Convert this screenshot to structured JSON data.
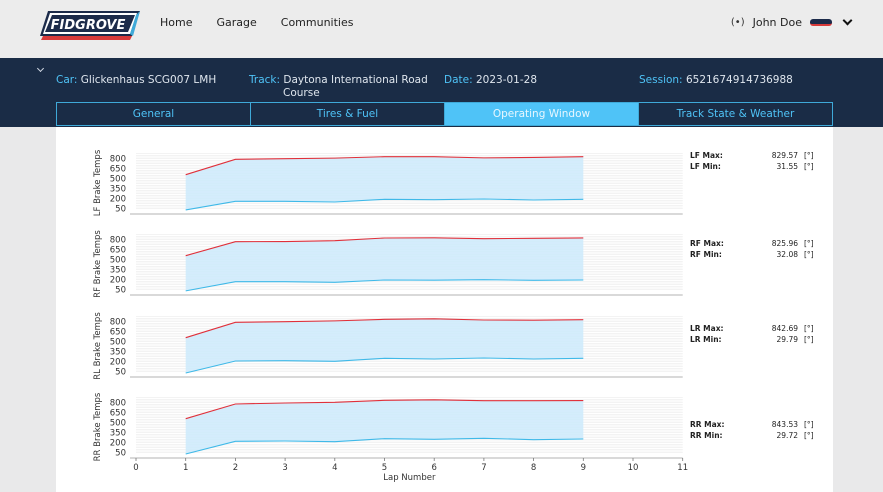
{
  "nav": {
    "brand": "FIDGROVE",
    "links": [
      "Home",
      "Garage",
      "Communities"
    ],
    "user_name": "John Doe"
  },
  "session_info": {
    "car_label": "Car:",
    "car": "Glickenhaus SCG007 LMH",
    "track_label": "Track:",
    "track_line1": "Daytona International Road",
    "track_line2": "Course",
    "date_label": "Date:",
    "date": "2023-01-28",
    "session_label": "Session:",
    "session": "6521674914736988"
  },
  "tabs": [
    {
      "label": "General",
      "active": false
    },
    {
      "label": "Tires & Fuel",
      "active": false
    },
    {
      "label": "Operating Window",
      "active": true
    },
    {
      "label": "Track State & Weather",
      "active": false
    }
  ],
  "colors": {
    "max_line": "#e0303a",
    "min_line": "#3fb9e8",
    "fill": "#cdeafb",
    "accent": "#4fc3f7",
    "navy": "#1a2c46"
  },
  "chart_data": {
    "type": "area",
    "xlabel": "Lap Number",
    "x_ticks": [
      0,
      1,
      2,
      3,
      4,
      5,
      6,
      7,
      8,
      9,
      10,
      11
    ],
    "x": [
      1,
      2,
      3,
      4,
      5,
      6,
      7,
      8,
      9
    ],
    "y_ticks": [
      50,
      200,
      350,
      500,
      650,
      800
    ],
    "ylim": [
      0,
      900
    ],
    "grid": true,
    "panels": [
      {
        "ylabel": "LF Brake Temps",
        "max": [
          560,
          790,
          800,
          808,
          830,
          829,
          812,
          818,
          829.57
        ],
        "min": [
          31.55,
          160,
          160,
          150,
          190,
          185,
          195,
          180,
          190
        ],
        "legend_max_label": "LF Max:",
        "legend_max": "829.57",
        "legend_min_label": "LF Min:",
        "legend_min": "31.55",
        "unit": "[°]"
      },
      {
        "ylabel": "RF Brake Temps",
        "max": [
          560,
          770,
          772,
          785,
          825,
          828,
          815,
          820,
          825.96
        ],
        "min": [
          32.08,
          170,
          170,
          160,
          195,
          192,
          200,
          190,
          195
        ],
        "legend_max_label": "RF Max:",
        "legend_max": "825.96",
        "legend_min_label": "RF Min:",
        "legend_min": "32.08",
        "unit": "[°]"
      },
      {
        "ylabel": "RL Brake Temps",
        "max": [
          560,
          790,
          800,
          812,
          835,
          842.69,
          825,
          822,
          830
        ],
        "min": [
          29.79,
          210,
          215,
          205,
          250,
          240,
          255,
          240,
          250
        ],
        "legend_max_label": "LR Max:",
        "legend_max": "842.69",
        "legend_min_label": "LR Min:",
        "legend_min": "29.79",
        "unit": "[°]"
      },
      {
        "ylabel": "RR Brake Temps",
        "max": [
          560,
          780,
          795,
          805,
          835,
          843.53,
          830,
          830,
          832
        ],
        "min": [
          29.72,
          220,
          225,
          215,
          260,
          250,
          265,
          245,
          255
        ],
        "legend_max_label": "RR Max:",
        "legend_max": "843.53",
        "legend_min_label": "RR Min:",
        "legend_min": "29.72",
        "unit": "[°]"
      }
    ]
  }
}
